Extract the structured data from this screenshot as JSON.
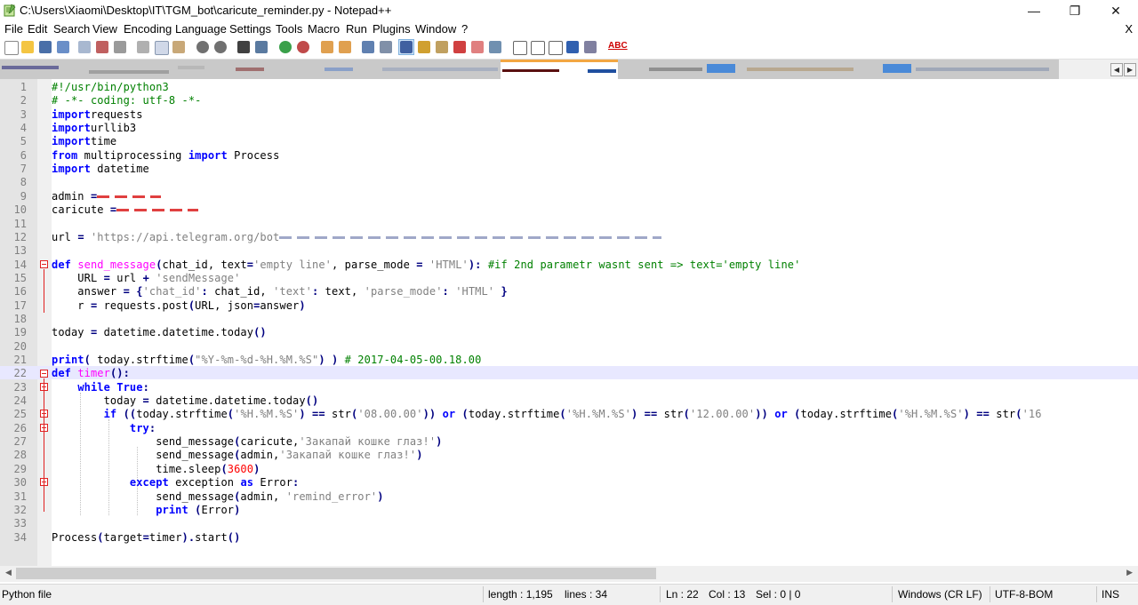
{
  "window": {
    "title": "C:\\Users\\Xiaomi\\Desktop\\IT\\TGM_bot\\caricute_reminder.py - Notepad++",
    "minimize": "—",
    "maximize": "❐",
    "close": "✕"
  },
  "menu": {
    "items": [
      "File",
      "Edit",
      "Search",
      "View",
      "Encoding",
      "Language",
      "Settings",
      "Tools",
      "Macro",
      "Run",
      "Plugins",
      "Window",
      "?"
    ],
    "close_doc": "X"
  },
  "toolbar": {
    "icons": [
      "new-file-icon",
      "open-file-icon",
      "save-icon",
      "save-all-icon",
      "close-icon",
      "close-all-icon",
      "print-icon",
      "cut-icon",
      "copy-icon",
      "paste-icon",
      "undo-icon",
      "redo-icon",
      "find-icon",
      "replace-icon",
      "zoom-in-icon",
      "zoom-out-icon",
      "sync-vertical-icon",
      "sync-horizontal-icon",
      "word-wrap-icon",
      "show-all-chars-icon",
      "indent-guide-icon",
      "udl-icon",
      "doc-map-icon",
      "function-list-icon",
      "folder-workspace-icon",
      "monitor-icon",
      "record-macro-icon",
      "stop-macro-icon",
      "play-macro-icon",
      "run-macro-multiple-icon",
      "save-macro-icon",
      "spell-check-icon"
    ],
    "spell_label": "ABC"
  },
  "tabs": {
    "left_arrow": "◀",
    "right_arrow": "▶"
  },
  "editor": {
    "current_line": 22
  },
  "statusbar": {
    "file_type": "Python file",
    "length": "length : 1,195",
    "lines": "lines : 34",
    "ln": "Ln : 22",
    "col": "Col : 13",
    "sel": "Sel : 0 | 0",
    "eol": "Windows (CR LF)",
    "encoding": "UTF-8-BOM",
    "mode": "INS"
  },
  "colors": {
    "keyword": "#0000ff",
    "string": "#808080",
    "comment": "#008000",
    "number": "#ff0000",
    "current_line": "#e8e8ff",
    "fold_marker": "#e02020"
  }
}
